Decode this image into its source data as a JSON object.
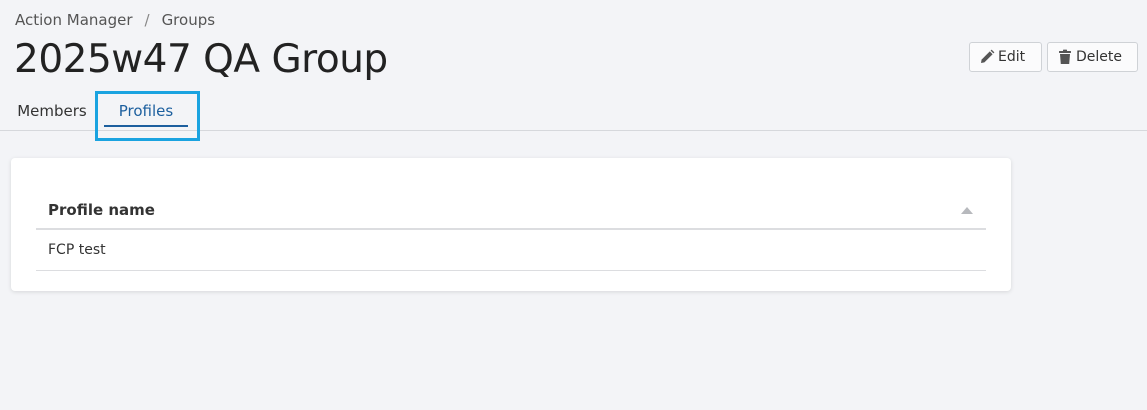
{
  "breadcrumb": {
    "items": [
      "Action Manager",
      "Groups"
    ],
    "separator": "/"
  },
  "page": {
    "title": "2025w47 QA Group"
  },
  "actions": {
    "edit_label": "Edit",
    "delete_label": "Delete"
  },
  "tabs": [
    {
      "label": "Members",
      "active": false
    },
    {
      "label": "Profiles",
      "active": true
    }
  ],
  "table": {
    "columns": [
      "Profile name"
    ],
    "rows": [
      [
        "FCP test"
      ]
    ]
  },
  "icons": {
    "edit": "pencil-icon",
    "delete": "trash-icon",
    "sort": "sort-ascending-icon"
  },
  "colors": {
    "accent": "#1c5f9e",
    "highlight": "#1aa3e0",
    "background": "#f3f4f7"
  }
}
